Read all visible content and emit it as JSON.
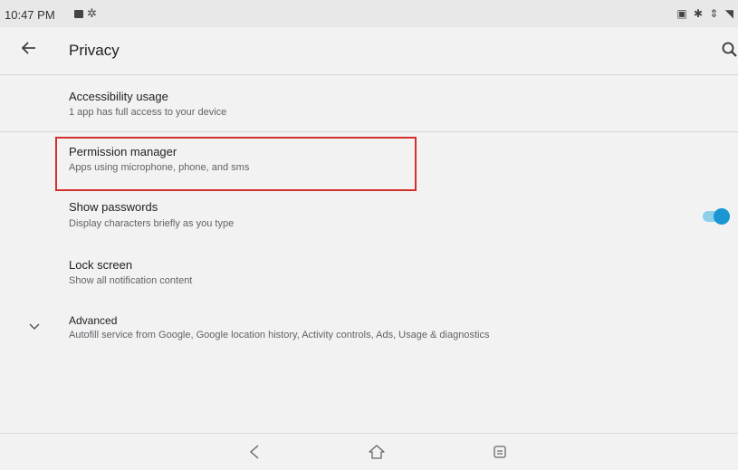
{
  "status_bar": {
    "time": "10:47 PM",
    "left_icons": [
      "image-icon",
      "gear-icon"
    ],
    "right_icons_text": "▣ ✱ ⇕ ◥",
    "right_icons": [
      "cast-icon",
      "bluetooth-icon",
      "data-arrows-icon",
      "wifi-icon"
    ]
  },
  "header": {
    "title": "Privacy",
    "back_icon": "arrow-back-icon",
    "search_icon": "search-icon"
  },
  "items": [
    {
      "title": "Accessibility usage",
      "summary": "1 app has full access to your device"
    },
    {
      "title": "Permission manager",
      "summary": "Apps using microphone, phone, and sms"
    },
    {
      "title": "Show passwords",
      "summary": "Display characters briefly as you type",
      "toggle_on": true
    },
    {
      "title": "Lock screen",
      "summary": "Show all notification content"
    },
    {
      "title": "Advanced",
      "summary": "Autofill service from Google, Google location history, Activity controls, Ads, Usage & diagnostics"
    }
  ],
  "nav_bar": {
    "icons": [
      "nav-back-icon",
      "nav-home-icon",
      "nav-recents-icon"
    ]
  },
  "colors": {
    "highlight": "#d32f2f",
    "toggle_accent": "#1a96d2",
    "background": "#f2f2f2"
  }
}
